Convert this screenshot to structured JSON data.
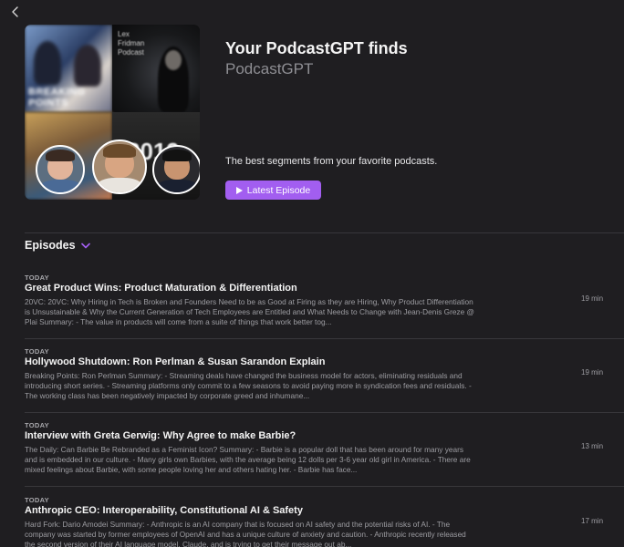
{
  "podcast": {
    "title": "Your PodcastGPT finds",
    "author": "PodcastGPT",
    "description": "The best segments from your favorite podcasts.",
    "latest_button_label": "Latest Episode"
  },
  "artwork": {
    "tile_text_breaking_points": "BREAKING POINTS",
    "tile_text_lex": "Lex\nFridman\nPodcast",
    "tile_text_year": "2019"
  },
  "episodes_section": {
    "label": "Episodes"
  },
  "episodes": [
    {
      "date": "TODAY",
      "title": "Great Product Wins: Product Maturation & Differentiation",
      "description": "20VC: 20VC: Why Hiring in Tech is Broken and Founders Need to be as Good at Firing as they are Hiring, Why Product Differentiation is Unsustainable & Why the Current Generation of Tech Employees are Entitled and What Needs to Change with Jean-Denis Greze @ Plai        Summary:       - The value in products will come from a suite of things that work better tog...",
      "duration": "19 min"
    },
    {
      "date": "TODAY",
      "title": "Hollywood Shutdown: Ron Perlman & Susan Sarandon Explain",
      "description": "Breaking Points: Ron Perlman       Summary:       - Streaming deals have changed the business model for actors, eliminating residuals and introducing short series. - Streaming platforms only commit to a few seasons to avoid paying more in syndication fees and residuals. - The working class has been negatively impacted by corporate greed and inhumane...",
      "duration": "19 min"
    },
    {
      "date": "TODAY",
      "title": "Interview with Greta Gerwig: Why Agree to make Barbie?",
      "description": "The Daily: Can Barbie Be Rebranded as a Feminist Icon?       Summary:       - Barbie is a popular doll that has been around for many years and is embedded in our culture. - Many girls own Barbies, with the average being 12 dolls per 3-6 year old girl in America. - There are mixed feelings about Barbie, with some people loving her and others hating her. - Barbie has face...",
      "duration": "13 min"
    },
    {
      "date": "TODAY",
      "title": "Anthropic CEO: Interoperability, Constitutional AI & Safety",
      "description": "Hard Fork: Dario Amodei       Summary:       - Anthropic is an AI company that is focused on AI safety and the potential risks of AI. - The company was started by former employees of OpenAI and has a unique culture of anxiety and caution. - Anthropic recently released the second version of their AI language model, Claude, and is trying to get their message out ab...",
      "duration": "17 min"
    }
  ],
  "colors": {
    "background": "#1f1e21",
    "accent": "#a25ef0",
    "secondary_text": "#8e8e93"
  },
  "icons": {
    "back": "chevron-left-icon",
    "play": "play-icon",
    "dropdown": "chevron-down-icon"
  }
}
